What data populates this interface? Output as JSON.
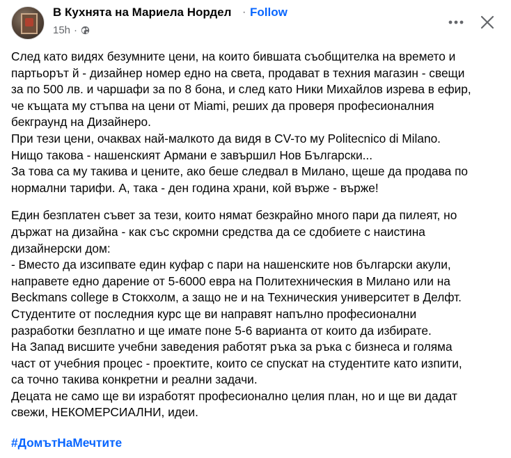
{
  "post": {
    "author": "В Кухнята на Мариела Нордел",
    "separator": "·",
    "follow_label": "Follow",
    "time": "15h",
    "meta_dot": "·",
    "paragraphs": [
      {
        "lines": [
          "След като видях безумните цени, на които бившата съобщителка на времето и",
          "партьорът й - дизайнер номер едно на света, продават в техния магазин - свещи",
          "за по 500 лв. и чаршафи за по 8 бона, и след като Ники Михайлов изрева в ефир,",
          "че къщата му стъпва на цени от Miami, реших да проверя професионалния",
          "бекграунд на Дизайнеро.",
          "При тези цени, очаквах най-малкото да видя в CV-то му Politecnico di Milano.",
          "Нищо такова - нашенският Армани е завършил Нов Български...",
          "За това са му такива и цените, ако беше следвал в Милано, щеше да продава по",
          "нормални тарифи. А, така - ден година храни, кой върже - върже!"
        ]
      },
      {
        "lines": [
          "Един безплатен съвет за тези, които нямат безкрайно много пари да пилеят, но",
          "държат на дизайна - как със скромни средства да се сдобиете с наистина",
          "дизайнерски дом:",
          "- Вместо да изсипвате един куфар с пари на нашенските нов български акули,",
          "направете едно дарение от 5-6000 евра на Политехническия в Милано или на",
          "Beckmans college в Стокхолм, а защо не и на Техническия университет в Делфт.",
          "Студентите от последния курс ще ви направят напълно професионални",
          "разработки безплатно и ще имате поне 5-6 варианта от които да избирате.",
          "На Запад висшите учебни заведения работят ръка за ръка с бизнеса и голяма",
          "част от учебния процес - проектите, които се спускат на студентите като изпити,",
          "са точно такива конкретни и реални задачи.",
          "Децата не само ще ви изработят професионално целия план, но и ще ви дадат",
          "свежи, НЕКОМЕРСИАЛНИ, идеи."
        ]
      }
    ],
    "hashtag": "#ДомътНаМечтите"
  },
  "icons": {
    "avatar": "page-avatar",
    "audience": "globe-icon",
    "more": "more-options-icon",
    "close": "close-icon"
  },
  "colors": {
    "link": "#0866ff",
    "secondary_text": "#65676b",
    "primary_text": "#050505"
  }
}
